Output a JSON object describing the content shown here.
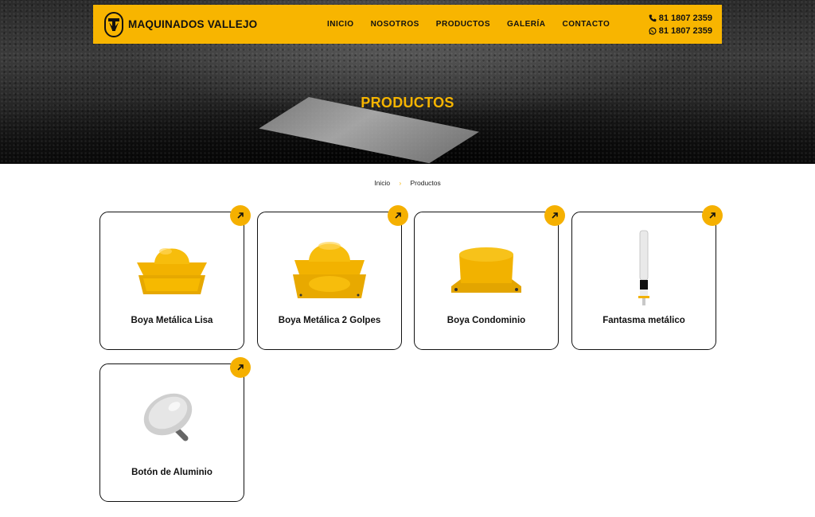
{
  "brand": {
    "name": "MAQUINADOS VALLEJO"
  },
  "nav": [
    {
      "label": "INICIO"
    },
    {
      "label": "NOSOTROS"
    },
    {
      "label": "PRODUCTOS"
    },
    {
      "label": "GALERÍA"
    },
    {
      "label": "CONTACTO"
    }
  ],
  "contact": {
    "phone": "81 1807 2359",
    "whatsapp": "81 1807 2359"
  },
  "hero": {
    "title": "PRODUCTOS"
  },
  "breadcrumb": {
    "home": "Inicio",
    "separator": "›",
    "current": "Productos"
  },
  "products": [
    {
      "name": "Boya Metálica Lisa",
      "icon": "arrow-up-right-icon"
    },
    {
      "name": "Boya Metálica 2 Golpes",
      "icon": "arrow-up-right-icon"
    },
    {
      "name": "Boya Condominio",
      "icon": "arrow-up-right-icon"
    },
    {
      "name": "Fantasma metálico",
      "icon": "arrow-up-right-icon"
    },
    {
      "name": "Botón de Aluminio",
      "icon": "arrow-up-right-icon"
    }
  ],
  "colors": {
    "accent": "#f8b500",
    "dark": "#111111"
  }
}
